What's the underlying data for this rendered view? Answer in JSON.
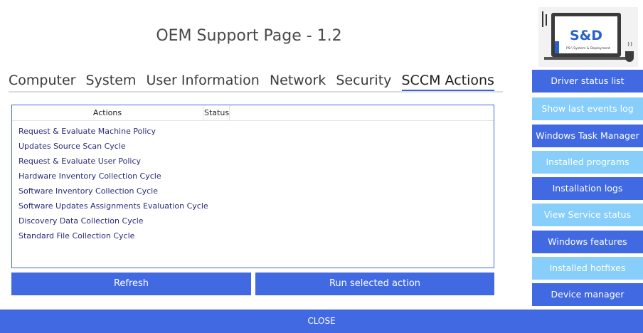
{
  "header": {
    "title": "OEM Support Page - 1.2"
  },
  "tabs": [
    {
      "label": "Computer"
    },
    {
      "label": "System"
    },
    {
      "label": "User Information"
    },
    {
      "label": "Network"
    },
    {
      "label": "Security"
    },
    {
      "label": "SCCM Actions",
      "active": true
    }
  ],
  "actions_list": {
    "columns": {
      "actions": "Actions",
      "status": "Status"
    },
    "rows": [
      "Request & Evaluate Machine Policy",
      "Updates Source Scan Cycle",
      "Request & Evaluate User Policy",
      "Hardware Inventory Collection Cycle",
      "Software Inventory Collection Cycle",
      "Software Updates Assignments Evaluation Cycle",
      "Discovery Data Collection Cycle",
      "Standard File Collection Cycle"
    ]
  },
  "buttons": {
    "refresh": "Refresh",
    "run": "Run selected action",
    "close": "CLOSE"
  },
  "logo": {
    "text": "S&D",
    "subtext": "PS:\\ System & Deployment"
  },
  "sidebar": {
    "items": [
      {
        "label": "Driver status list",
        "style": "dark"
      },
      {
        "label": "Show last events log",
        "style": "light"
      },
      {
        "label": "Windows Task Manager",
        "style": "dark"
      },
      {
        "label": "Installed programs",
        "style": "light"
      },
      {
        "label": "Installation logs",
        "style": "dark"
      },
      {
        "label": "View Service status",
        "style": "light"
      },
      {
        "label": "Windows features",
        "style": "dark"
      },
      {
        "label": "Installed hotfixes",
        "style": "light"
      },
      {
        "label": "Device manager",
        "style": "dark"
      }
    ]
  },
  "colors": {
    "accent": "#4169e1",
    "accent_light": "#87cefa",
    "list_text": "#2a2a7a"
  }
}
